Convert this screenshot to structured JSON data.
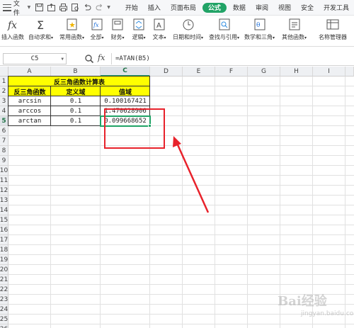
{
  "menubar": {
    "file_label": "文件",
    "tabs": [
      "开始",
      "插入",
      "页面布局",
      "公式",
      "数据",
      "审阅",
      "视图",
      "安全",
      "开发工具"
    ],
    "active_tab": "公式"
  },
  "ribbon": {
    "buttons": [
      {
        "label": "插入函数",
        "icon": "fx-icon"
      },
      {
        "label": "自动求和",
        "icon": "sigma-icon"
      },
      {
        "label": "常用函数",
        "icon": "star-function-icon"
      },
      {
        "label": "全部",
        "icon": "function-book-icon"
      },
      {
        "label": "财务",
        "icon": "finance-icon"
      },
      {
        "label": "逻辑",
        "icon": "logic-icon"
      },
      {
        "label": "文本",
        "icon": "text-icon"
      },
      {
        "label": "日期和时间",
        "icon": "clock-icon"
      },
      {
        "label": "查找与引用",
        "icon": "search-reference-icon"
      },
      {
        "label": "数学和三角",
        "icon": "math-icon"
      },
      {
        "label": "其他函数",
        "icon": "more-functions-icon"
      },
      {
        "label": "名称管理器",
        "icon": "name-manager-icon"
      }
    ]
  },
  "formula_bar": {
    "name_box": "C5",
    "fx_label": "fx",
    "formula": "=ATAN(B5)"
  },
  "grid": {
    "columns": [
      "A",
      "B",
      "C",
      "D",
      "E",
      "F",
      "G",
      "H",
      "I"
    ],
    "rows": [
      "1",
      "2",
      "3",
      "4",
      "5",
      "6",
      "7",
      "8",
      "9",
      "10",
      "11",
      "12",
      "13",
      "14",
      "15",
      "16",
      "17",
      "18",
      "19",
      "20",
      "21",
      "22",
      "23",
      "24",
      "25",
      "26"
    ],
    "selected_column": "C",
    "selected_row": "5"
  },
  "table": {
    "title": "反三角函数计算表",
    "headers": [
      "反三角函数",
      "定义域",
      "值域"
    ],
    "rows": [
      [
        "arcsin",
        "0.1",
        "0.100167421"
      ],
      [
        "arccos",
        "0.1",
        "1.470628906"
      ],
      [
        "arctan",
        "0.1",
        "0.099668652"
      ]
    ]
  },
  "colors": {
    "accent": "#21a366",
    "header_fill": "#ffff00",
    "annotation": "#e8222b"
  },
  "watermark": {
    "text": "Bai经验",
    "sub": "jingyan.baidu.com"
  }
}
